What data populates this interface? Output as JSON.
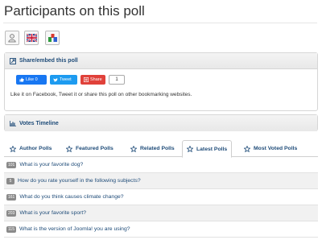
{
  "page": {
    "title": "Participants on this poll"
  },
  "toolbar": {
    "icons": [
      "user-icon",
      "uk-flag-icon",
      "chart-icon"
    ]
  },
  "share_panel": {
    "heading": "Share/embed this poll",
    "like_label": "Like 0",
    "tweet_label": "Tweet",
    "share_label": "Share",
    "share_count": "1",
    "description": "Like it on Facebook, Tweet it or share this poll on other bookmarking websites."
  },
  "timeline_panel": {
    "heading": "Votes Timeline"
  },
  "tabs": [
    {
      "label": "Author Polls"
    },
    {
      "label": "Featured Polls"
    },
    {
      "label": "Related Polls"
    },
    {
      "label": "Latest Polls"
    },
    {
      "label": "Most Voted Polls"
    }
  ],
  "polls": [
    {
      "count": "101",
      "question": "What is your favorite dog?"
    },
    {
      "count": "5",
      "question": "How do you rate yourself in the following subjects?"
    },
    {
      "count": "161",
      "question": "What do you think causes climate change?"
    },
    {
      "count": "203",
      "question": "What is your favorite sport?"
    },
    {
      "count": "115",
      "question": "What is the version of Joomla! you are using?"
    }
  ],
  "colors": {
    "link": "#1e4b78",
    "facebook": "#1877f2",
    "twitter": "#1d9bf0",
    "share": "#e0413a"
  }
}
